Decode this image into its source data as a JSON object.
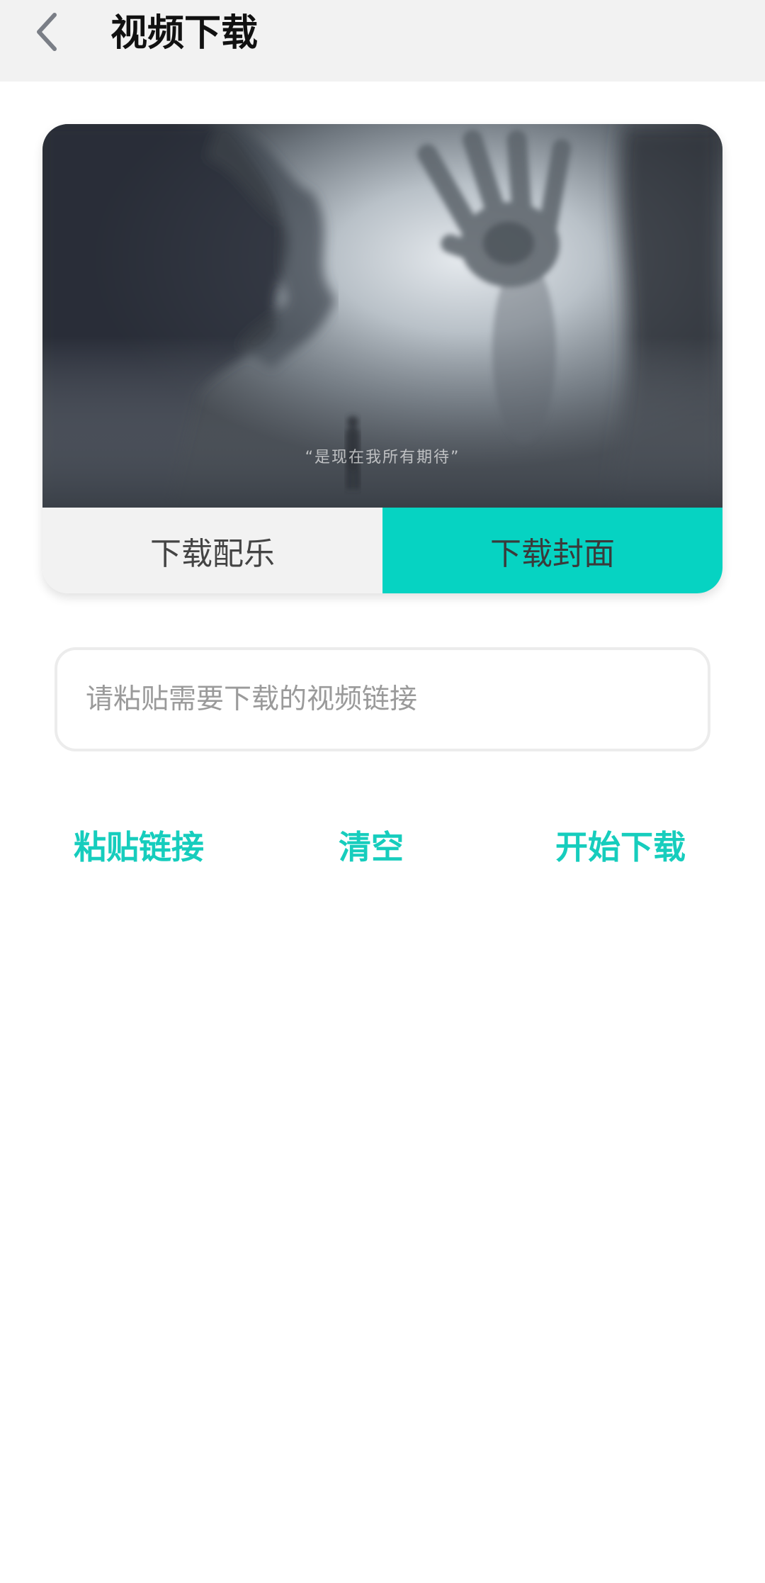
{
  "header": {
    "title": "视频下载",
    "back_icon": "chevron-left-icon"
  },
  "preview": {
    "caption": "“是现在我所有期待”"
  },
  "card_buttons": {
    "download_music": "下载配乐",
    "download_cover": "下载封面"
  },
  "input": {
    "placeholder": "请粘贴需要下载的视频链接",
    "value": ""
  },
  "actions": {
    "paste": "粘贴链接",
    "clear": "清空",
    "start": "开始下载"
  },
  "colors": {
    "accent": "#06d3c2",
    "action_text": "#16cdbd",
    "header_bg": "#f2f2f2"
  }
}
